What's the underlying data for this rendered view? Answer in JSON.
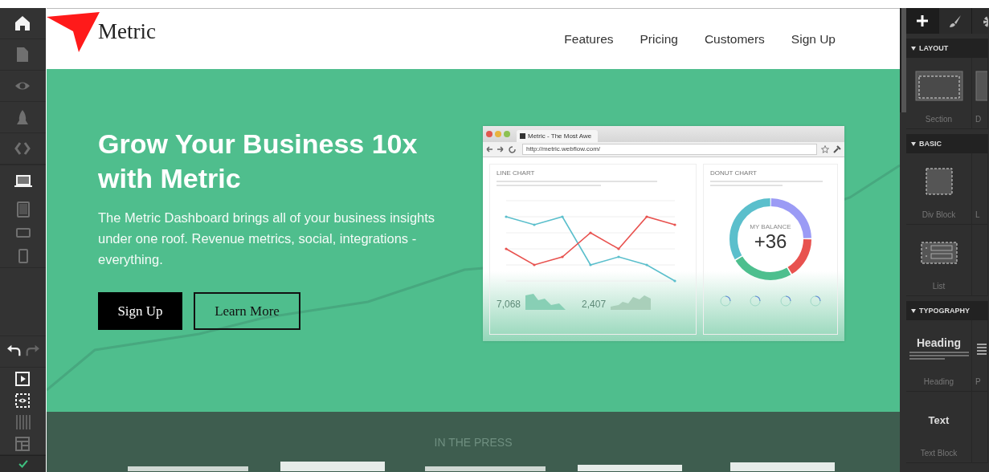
{
  "left_toolbar": {
    "top": [
      {
        "kind": "home",
        "active": true
      },
      {
        "kind": "page",
        "active": false
      },
      {
        "kind": "eye",
        "active": false
      },
      {
        "kind": "rocket",
        "active": false
      },
      {
        "kind": "code",
        "active": false
      }
    ],
    "devices": [
      {
        "kind": "desktop",
        "selected": true
      },
      {
        "kind": "tablet",
        "selected": false
      },
      {
        "kind": "phone-landscape",
        "selected": false
      },
      {
        "kind": "phone",
        "selected": false
      }
    ],
    "history": [
      {
        "kind": "undo",
        "disabled": false
      },
      {
        "kind": "redo",
        "disabled": true
      }
    ],
    "bottom": [
      {
        "kind": "preview",
        "active": true
      },
      {
        "kind": "outline",
        "active": true
      },
      {
        "kind": "grid",
        "active": false
      },
      {
        "kind": "layout",
        "active": false
      }
    ],
    "status": {
      "kind": "check"
    }
  },
  "site": {
    "logo": "Metric",
    "nav": [
      "Features",
      "Pricing",
      "Customers",
      "Sign Up"
    ],
    "hero": {
      "heading": "Grow Your Business 10x with Metric",
      "text": "The Metric Dashboard brings all of your business insights under one roof. Revenue metrics, social, integrations - everything.",
      "buttons": [
        {
          "label": "Sign Up",
          "kind": "primary"
        },
        {
          "label": "Learn More",
          "kind": "outline"
        }
      ],
      "mockup": {
        "tab_title": "Metric - The Most Awe",
        "url": "http://metric.webflow.com/",
        "cards": [
          {
            "kind": "line",
            "title": "LINE CHART"
          },
          {
            "kind": "donut",
            "title": "DONUT CHART",
            "center_label": "MY BALANCE",
            "center_value": "+36"
          }
        ],
        "stats": [
          "7,068",
          "2,407"
        ]
      }
    },
    "press": {
      "title": "IN THE PRESS"
    }
  },
  "right_panel": {
    "tabs": [
      {
        "kind": "add",
        "selected": true
      },
      {
        "kind": "style",
        "selected": false
      },
      {
        "kind": "settings",
        "selected": false
      }
    ],
    "sections": [
      {
        "title": "LAYOUT",
        "expanded": true,
        "rows": [
          [
            {
              "kind": "section",
              "label": "Section"
            },
            {
              "kind": "container",
              "label": "D"
            }
          ]
        ]
      },
      {
        "title": "BASIC",
        "expanded": true,
        "rows": [
          [
            {
              "kind": "div",
              "label": "Div Block"
            },
            {
              "kind": "blank",
              "label": "L"
            }
          ],
          [
            {
              "kind": "list",
              "label": "List"
            },
            {
              "kind": "blank"
            }
          ]
        ]
      },
      {
        "title": "TYPOGRAPHY",
        "expanded": true,
        "rows": [
          [
            {
              "kind": "heading",
              "label": "Heading",
              "sample": "Heading"
            },
            {
              "kind": "paragraph",
              "label": "P"
            }
          ],
          [
            {
              "kind": "text",
              "label": "Text Block",
              "sample": "Text"
            },
            {
              "kind": "blank"
            }
          ]
        ]
      }
    ]
  }
}
